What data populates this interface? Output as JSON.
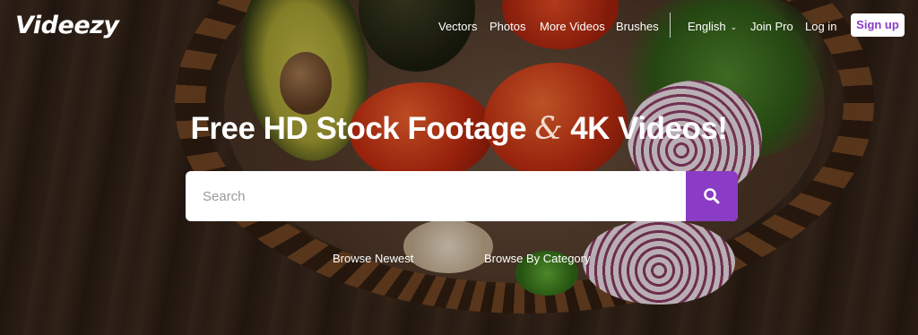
{
  "brand": {
    "logo_text": "Videezy",
    "accent_color": "#8a3cc4"
  },
  "nav": {
    "links": [
      "Vectors",
      "Photos",
      "More Videos",
      "Brushes"
    ],
    "language": "English",
    "join_pro": "Join Pro",
    "log_in": "Log in",
    "sign_up": "Sign up"
  },
  "hero": {
    "headline_part1": "Free HD Stock Footage",
    "headline_amp": "&",
    "headline_part2": "4K Videos!"
  },
  "search": {
    "placeholder": "Search",
    "button_icon": "search-icon"
  },
  "browse": {
    "newest": "Browse Newest",
    "category": "Browse By Category"
  }
}
